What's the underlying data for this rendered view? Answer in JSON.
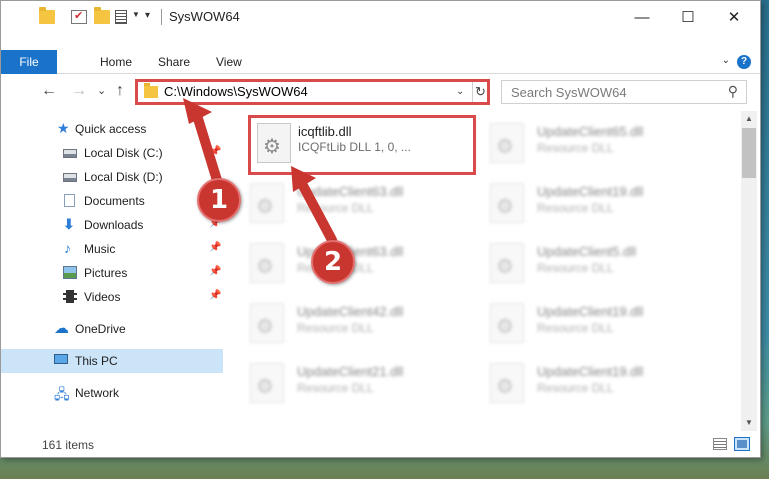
{
  "window": {
    "title": "SysWOW64",
    "controls": {
      "minimize": "—",
      "maximize": "☐",
      "close": "✕"
    }
  },
  "ribbon": {
    "tabs": [
      {
        "label": "File",
        "active": true
      },
      {
        "label": "Home"
      },
      {
        "label": "Share"
      },
      {
        "label": "View"
      }
    ],
    "help": "?"
  },
  "nav": {
    "back": "←",
    "forward": "→",
    "recent": "⌄",
    "up": "↑",
    "address": "C:\\Windows\\SysWOW64",
    "search_placeholder": "Search SysWOW64"
  },
  "sidebar": {
    "items": [
      {
        "label": "Quick access",
        "icon": "star-icon"
      },
      {
        "label": "Local Disk (C:)",
        "icon": "disk-icon",
        "pinned": true
      },
      {
        "label": "Local Disk (D:)",
        "icon": "disk-icon",
        "pinned": false
      },
      {
        "label": "Documents",
        "icon": "documents-icon",
        "pinned": true
      },
      {
        "label": "Downloads",
        "icon": "downloads-icon",
        "pinned": true
      },
      {
        "label": "Music",
        "icon": "music-icon",
        "pinned": true
      },
      {
        "label": "Pictures",
        "icon": "pictures-icon",
        "pinned": true
      },
      {
        "label": "Videos",
        "icon": "videos-icon",
        "pinned": true
      },
      {
        "label": "OneDrive",
        "icon": "onedrive-icon"
      },
      {
        "label": "This PC",
        "icon": "computer-icon",
        "selected": true
      },
      {
        "label": "Network",
        "icon": "network-icon"
      }
    ]
  },
  "files": [
    {
      "name": "icqftlib.dll",
      "type": "ICQFtLib DLL 1, 0, ...",
      "highlighted": true
    },
    {
      "name": "UpdateClient65.dll",
      "type": "Resource DLL"
    },
    {
      "name": "UpdateClient63.dll",
      "type": "Resource DLL"
    },
    {
      "name": "UpdateClient19.dll",
      "type": "Resource DLL"
    },
    {
      "name": "UpdateClient63.dll",
      "type": "Resource DLL"
    },
    {
      "name": "UpdateClient5.dll",
      "type": "Resource DLL"
    },
    {
      "name": "UpdateClient42.dll",
      "type": "Resource DLL"
    },
    {
      "name": "UpdateClient19.dll",
      "type": "Resource DLL"
    },
    {
      "name": "UpdateClient21.dll",
      "type": "Resource DLL"
    },
    {
      "name": "UpdateClient19.dll",
      "type": "Resource DLL"
    }
  ],
  "status": {
    "item_count": "161 items"
  },
  "annotations": [
    {
      "number": "1"
    },
    {
      "number": "2"
    }
  ],
  "colors": {
    "accent": "#1a73c8",
    "highlight_border": "#d94b4b",
    "badge": "#c9362f",
    "selection": "#cce4f7"
  }
}
